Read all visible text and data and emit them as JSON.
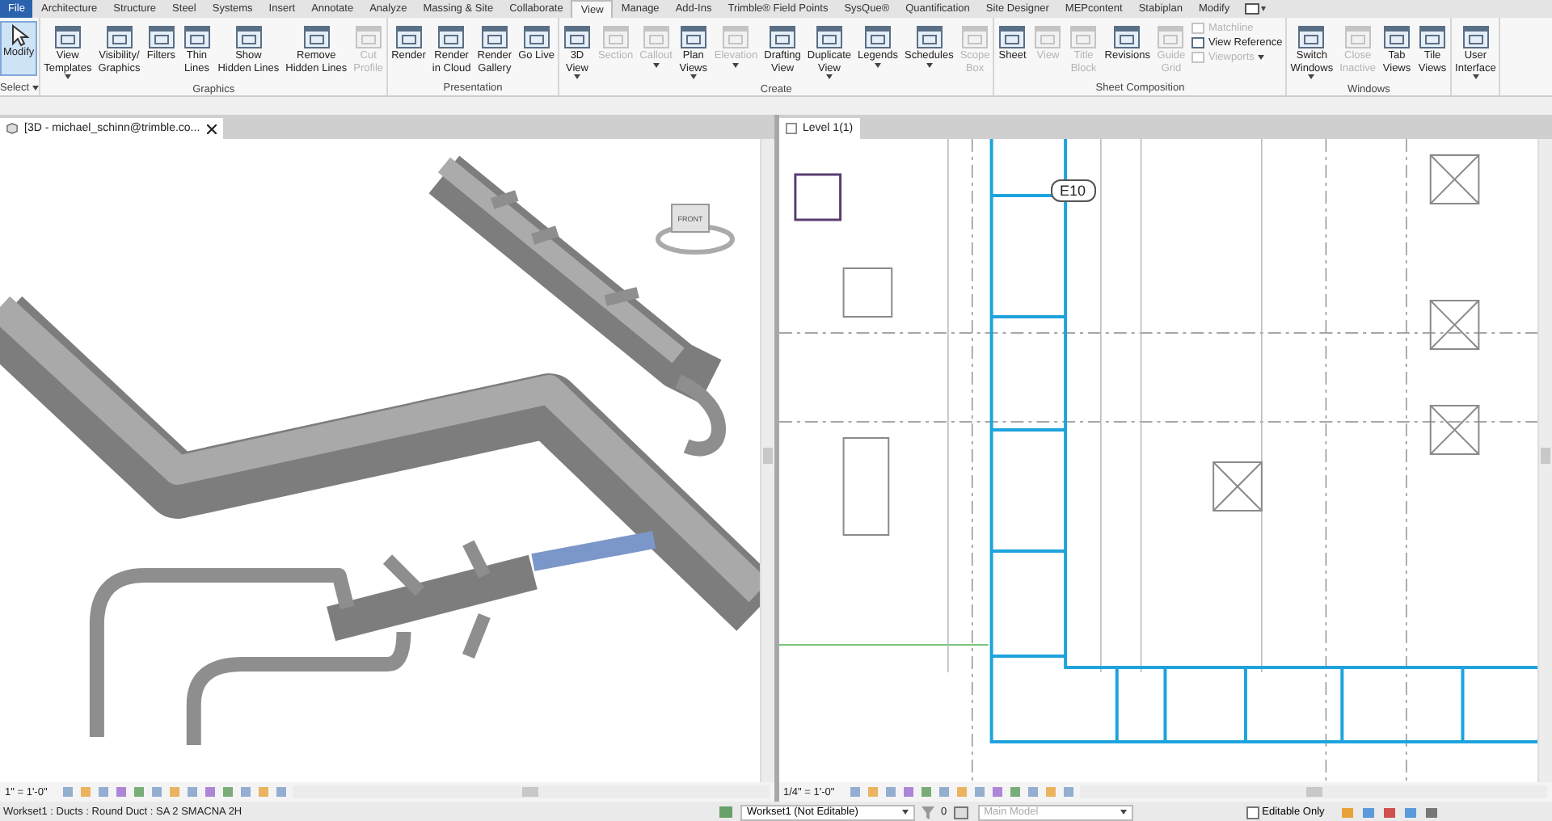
{
  "ribbon_tabs": [
    {
      "label": "File",
      "selected": false,
      "kind": "file"
    },
    {
      "label": "Architecture",
      "selected": false,
      "kind": "tab"
    },
    {
      "label": "Structure",
      "selected": false,
      "kind": "tab"
    },
    {
      "label": "Steel",
      "selected": false,
      "kind": "tab"
    },
    {
      "label": "Systems",
      "selected": false,
      "kind": "tab"
    },
    {
      "label": "Insert",
      "selected": false,
      "kind": "tab"
    },
    {
      "label": "Annotate",
      "selected": false,
      "kind": "tab"
    },
    {
      "label": "Analyze",
      "selected": false,
      "kind": "tab"
    },
    {
      "label": "Massing & Site",
      "selected": false,
      "kind": "tab"
    },
    {
      "label": "Collaborate",
      "selected": false,
      "kind": "tab"
    },
    {
      "label": "View",
      "selected": true,
      "kind": "tab"
    },
    {
      "label": "Manage",
      "selected": false,
      "kind": "tab"
    },
    {
      "label": "Add-Ins",
      "selected": false,
      "kind": "tab"
    },
    {
      "label": "Trimble® Field Points",
      "selected": false,
      "kind": "tab"
    },
    {
      "label": "SysQue®",
      "selected": false,
      "kind": "tab"
    },
    {
      "label": "Quantification",
      "selected": false,
      "kind": "tab"
    },
    {
      "label": "Site Designer",
      "selected": false,
      "kind": "tab"
    },
    {
      "label": "MEPcontent",
      "selected": false,
      "kind": "tab"
    },
    {
      "label": "Stabiplan",
      "selected": false,
      "kind": "tab"
    },
    {
      "label": "Modify",
      "selected": false,
      "kind": "tab"
    }
  ],
  "ribbon_groups": [
    {
      "label": "Select",
      "dropdown": true,
      "buttons": [
        {
          "label": "Modify",
          "kind": "tool",
          "disabled": false,
          "dropdown": false,
          "selected": true
        }
      ]
    },
    {
      "label": "Graphics",
      "dropdown": false,
      "buttons": [
        {
          "label": "View\nTemplates",
          "kind": "large",
          "disabled": false,
          "dropdown": true,
          "selected": false
        },
        {
          "label": "Visibility/\nGraphics",
          "kind": "large",
          "disabled": false,
          "dropdown": false,
          "selected": false
        },
        {
          "label": "Filters",
          "kind": "large",
          "disabled": false,
          "dropdown": false,
          "selected": false
        },
        {
          "label": "Thin\nLines",
          "kind": "large",
          "disabled": false,
          "dropdown": false,
          "selected": false
        },
        {
          "label": "Show\nHidden Lines",
          "kind": "large",
          "disabled": false,
          "dropdown": false,
          "selected": false
        },
        {
          "label": "Remove\nHidden Lines",
          "kind": "large",
          "disabled": false,
          "dropdown": false,
          "selected": false
        },
        {
          "label": "Cut\nProfile",
          "kind": "large",
          "disabled": true,
          "dropdown": false,
          "selected": false
        }
      ]
    },
    {
      "label": "Presentation",
      "dropdown": false,
      "buttons": [
        {
          "label": "Render",
          "kind": "large",
          "disabled": false,
          "dropdown": false,
          "selected": false
        },
        {
          "label": "Render\nin Cloud",
          "kind": "large",
          "disabled": false,
          "dropdown": false,
          "selected": false
        },
        {
          "label": "Render\nGallery",
          "kind": "large",
          "disabled": false,
          "dropdown": false,
          "selected": false
        },
        {
          "label": "Go Live",
          "kind": "large",
          "disabled": false,
          "dropdown": false,
          "selected": false
        }
      ]
    },
    {
      "label": "Create",
      "dropdown": false,
      "buttons": [
        {
          "label": "3D\nView",
          "kind": "large",
          "disabled": false,
          "dropdown": true,
          "selected": false
        },
        {
          "label": "Section",
          "kind": "large",
          "disabled": true,
          "dropdown": false,
          "selected": false
        },
        {
          "label": "Callout",
          "kind": "large",
          "disabled": true,
          "dropdown": true,
          "selected": false
        },
        {
          "label": "Plan\nViews",
          "kind": "large",
          "disabled": false,
          "dropdown": true,
          "selected": false
        },
        {
          "label": "Elevation",
          "kind": "large",
          "disabled": true,
          "dropdown": true,
          "selected": false
        },
        {
          "label": "Drafting\nView",
          "kind": "large",
          "disabled": false,
          "dropdown": false,
          "selected": false
        },
        {
          "label": "Duplicate\nView",
          "kind": "large",
          "disabled": false,
          "dropdown": true,
          "selected": false
        },
        {
          "label": "Legends",
          "kind": "large",
          "disabled": false,
          "dropdown": true,
          "selected": false
        },
        {
          "label": "Schedules",
          "kind": "large",
          "disabled": false,
          "dropdown": true,
          "selected": false
        },
        {
          "label": "Scope\nBox",
          "kind": "large",
          "disabled": true,
          "dropdown": false,
          "selected": false
        }
      ]
    },
    {
      "label": "Sheet Composition",
      "dropdown": false,
      "buttons": [
        {
          "label": "Sheet",
          "kind": "large",
          "disabled": false,
          "dropdown": false,
          "selected": false
        },
        {
          "label": "View",
          "kind": "large",
          "disabled": true,
          "dropdown": false,
          "selected": false
        },
        {
          "label": "Title\nBlock",
          "kind": "large",
          "disabled": true,
          "dropdown": false,
          "selected": false
        },
        {
          "label": "Revisions",
          "kind": "large",
          "disabled": false,
          "dropdown": false,
          "selected": false
        },
        {
          "label": "Guide\nGrid",
          "kind": "large",
          "disabled": true,
          "dropdown": false,
          "selected": false
        },
        {
          "label": "Matchline",
          "kind": "small",
          "disabled": true,
          "dropdown": false,
          "selected": false
        },
        {
          "label": "View Reference",
          "kind": "small",
          "disabled": false,
          "dropdown": false,
          "selected": false
        },
        {
          "label": "Viewports",
          "kind": "small",
          "disabled": true,
          "dropdown": true,
          "selected": false
        }
      ]
    },
    {
      "label": "Windows",
      "dropdown": false,
      "buttons": [
        {
          "label": "Switch\nWindows",
          "kind": "large",
          "disabled": false,
          "dropdown": true,
          "selected": false
        },
        {
          "label": "Close\nInactive",
          "kind": "large",
          "disabled": true,
          "dropdown": false,
          "selected": false
        },
        {
          "label": "Tab\nViews",
          "kind": "large",
          "disabled": false,
          "dropdown": false,
          "selected": false
        },
        {
          "label": "Tile\nViews",
          "kind": "large",
          "disabled": false,
          "dropdown": false,
          "selected": false
        }
      ]
    },
    {
      "dropdown": false,
      "buttons": [
        {
          "label": "User\nInterface",
          "kind": "large",
          "disabled": false,
          "dropdown": true,
          "selected": false
        }
      ]
    }
  ],
  "views": [
    {
      "kind": "model",
      "tab": "[3D - michael_schinn@trimble.co...",
      "closable": true,
      "scale": "1\" = 1'-0\"",
      "cube_face": "FRONT"
    },
    {
      "kind": "plan",
      "tab": "Level 1(1)",
      "closable": false,
      "scale": "1/4\" = 1'-0\"",
      "tag": "E10"
    }
  ],
  "status_bar": {
    "message": "Workset1 : Ducts : Round Duct : SA 2 SMACNA 2H",
    "workset": "Workset1 (Not Editable)",
    "count": "0",
    "design_option": "Main Model",
    "editable_only": {
      "label": "Editable Only",
      "checked": false
    }
  }
}
